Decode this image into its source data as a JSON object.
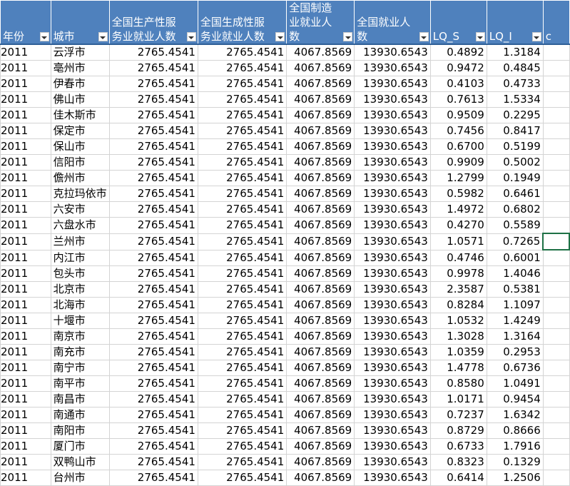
{
  "headers": [
    {
      "key": "year",
      "label": "年份"
    },
    {
      "key": "city",
      "label": "城市"
    },
    {
      "key": "prod_service",
      "label": "全国生产性服务业就业人数"
    },
    {
      "key": "gen_service",
      "label": "全国生成性服务业就业人数"
    },
    {
      "key": "manufacturing",
      "label": "全国制造业就业人数"
    },
    {
      "key": "employment",
      "label": "全国就业人数"
    },
    {
      "key": "lq_s",
      "label": "LQ_S"
    },
    {
      "key": "lq_i",
      "label": "LQ_I"
    },
    {
      "key": "next",
      "label": "c"
    }
  ],
  "rows": [
    [
      "2011",
      "云浮市",
      "2765.4541",
      "2765.4541",
      "4067.8569",
      "13930.6543",
      "0.4892",
      "1.3184"
    ],
    [
      "2011",
      "亳州市",
      "2765.4541",
      "2765.4541",
      "4067.8569",
      "13930.6543",
      "0.9472",
      "0.4845"
    ],
    [
      "2011",
      "伊春市",
      "2765.4541",
      "2765.4541",
      "4067.8569",
      "13930.6543",
      "0.4103",
      "0.4733"
    ],
    [
      "2011",
      "佛山市",
      "2765.4541",
      "2765.4541",
      "4067.8569",
      "13930.6543",
      "0.7613",
      "1.5334"
    ],
    [
      "2011",
      "佳木斯市",
      "2765.4541",
      "2765.4541",
      "4067.8569",
      "13930.6543",
      "0.9509",
      "0.2295"
    ],
    [
      "2011",
      "保定市",
      "2765.4541",
      "2765.4541",
      "4067.8569",
      "13930.6543",
      "0.7456",
      "0.8417"
    ],
    [
      "2011",
      "保山市",
      "2765.4541",
      "2765.4541",
      "4067.8569",
      "13930.6543",
      "0.6700",
      "0.5199"
    ],
    [
      "2011",
      "信阳市",
      "2765.4541",
      "2765.4541",
      "4067.8569",
      "13930.6543",
      "0.9909",
      "0.5002"
    ],
    [
      "2011",
      "儋州市",
      "2765.4541",
      "2765.4541",
      "4067.8569",
      "13930.6543",
      "1.2799",
      "0.1949"
    ],
    [
      "2011",
      "克拉玛依市",
      "2765.4541",
      "2765.4541",
      "4067.8569",
      "13930.6543",
      "0.5982",
      "0.6461"
    ],
    [
      "2011",
      "六安市",
      "2765.4541",
      "2765.4541",
      "4067.8569",
      "13930.6543",
      "1.4972",
      "0.6802"
    ],
    [
      "2011",
      "六盘水市",
      "2765.4541",
      "2765.4541",
      "4067.8569",
      "13930.6543",
      "0.4270",
      "0.5589"
    ],
    [
      "2011",
      "兰州市",
      "2765.4541",
      "2765.4541",
      "4067.8569",
      "13930.6543",
      "1.0571",
      "0.7265"
    ],
    [
      "2011",
      "内江市",
      "2765.4541",
      "2765.4541",
      "4067.8569",
      "13930.6543",
      "0.4746",
      "0.6001"
    ],
    [
      "2011",
      "包头市",
      "2765.4541",
      "2765.4541",
      "4067.8569",
      "13930.6543",
      "0.9978",
      "1.4046"
    ],
    [
      "2011",
      "北京市",
      "2765.4541",
      "2765.4541",
      "4067.8569",
      "13930.6543",
      "2.3587",
      "0.5381"
    ],
    [
      "2011",
      "北海市",
      "2765.4541",
      "2765.4541",
      "4067.8569",
      "13930.6543",
      "0.8284",
      "1.1097"
    ],
    [
      "2011",
      "十堰市",
      "2765.4541",
      "2765.4541",
      "4067.8569",
      "13930.6543",
      "1.0532",
      "1.4249"
    ],
    [
      "2011",
      "南京市",
      "2765.4541",
      "2765.4541",
      "4067.8569",
      "13930.6543",
      "1.3028",
      "1.3164"
    ],
    [
      "2011",
      "南充市",
      "2765.4541",
      "2765.4541",
      "4067.8569",
      "13930.6543",
      "1.0359",
      "0.2953"
    ],
    [
      "2011",
      "南宁市",
      "2765.4541",
      "2765.4541",
      "4067.8569",
      "13930.6543",
      "1.4778",
      "0.6736"
    ],
    [
      "2011",
      "南平市",
      "2765.4541",
      "2765.4541",
      "4067.8569",
      "13930.6543",
      "0.8580",
      "1.0491"
    ],
    [
      "2011",
      "南昌市",
      "2765.4541",
      "2765.4541",
      "4067.8569",
      "13930.6543",
      "1.0171",
      "0.9454"
    ],
    [
      "2011",
      "南通市",
      "2765.4541",
      "2765.4541",
      "4067.8569",
      "13930.6543",
      "0.7237",
      "1.6342"
    ],
    [
      "2011",
      "南阳市",
      "2765.4541",
      "2765.4541",
      "4067.8569",
      "13930.6543",
      "0.8729",
      "0.8666"
    ],
    [
      "2011",
      "厦门市",
      "2765.4541",
      "2765.4541",
      "4067.8569",
      "13930.6543",
      "0.6733",
      "1.7916"
    ],
    [
      "2011",
      "双鸭山市",
      "2765.4541",
      "2765.4541",
      "4067.8569",
      "13930.6543",
      "0.8323",
      "0.1329"
    ],
    [
      "2011",
      "台州市",
      "2765.4541",
      "2765.4541",
      "4067.8569",
      "13930.6543",
      "0.6414",
      "1.2506"
    ]
  ],
  "active_cell_row": 12,
  "colors": {
    "header_bg": "#4f81bd",
    "grid": "#d4d4d4",
    "selection": "#1e7145"
  }
}
